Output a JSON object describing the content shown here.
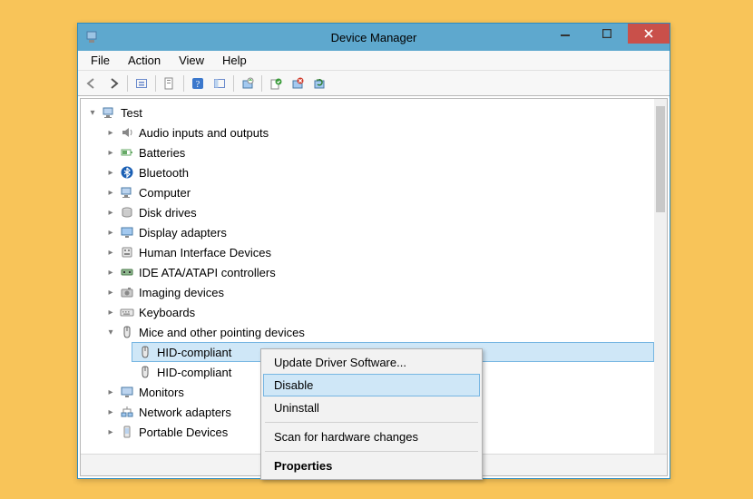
{
  "window": {
    "title": "Device Manager"
  },
  "menubar": [
    "File",
    "Action",
    "View",
    "Help"
  ],
  "toolbar": [
    {
      "name": "back-icon"
    },
    {
      "name": "forward-icon"
    },
    {
      "sep": true
    },
    {
      "name": "show-hidden-icon"
    },
    {
      "sep": true
    },
    {
      "name": "properties-icon"
    },
    {
      "sep": true
    },
    {
      "name": "help-icon"
    },
    {
      "name": "panel-icon"
    },
    {
      "sep": true
    },
    {
      "name": "update-driver-icon"
    },
    {
      "sep": true
    },
    {
      "name": "add-icon"
    },
    {
      "name": "uninstall-icon"
    },
    {
      "name": "scan-icon"
    }
  ],
  "tree": {
    "root": {
      "label": "Test",
      "expander": "▾",
      "icon": "computer-icon"
    },
    "categories": [
      {
        "label": "Audio inputs and outputs",
        "expander": "▸",
        "icon": "audio-icon"
      },
      {
        "label": "Batteries",
        "expander": "▸",
        "icon": "battery-icon"
      },
      {
        "label": "Bluetooth",
        "expander": "▸",
        "icon": "bluetooth-icon"
      },
      {
        "label": "Computer",
        "expander": "▸",
        "icon": "computer-icon"
      },
      {
        "label": "Disk drives",
        "expander": "▸",
        "icon": "disk-icon"
      },
      {
        "label": "Display adapters",
        "expander": "▸",
        "icon": "display-icon"
      },
      {
        "label": "Human Interface Devices",
        "expander": "▸",
        "icon": "hid-icon"
      },
      {
        "label": "IDE ATA/ATAPI controllers",
        "expander": "▸",
        "icon": "ide-icon"
      },
      {
        "label": "Imaging devices",
        "expander": "▸",
        "icon": "camera-icon"
      },
      {
        "label": "Keyboards",
        "expander": "▸",
        "icon": "keyboard-icon"
      },
      {
        "label": "Mice and other pointing devices",
        "expander": "▾",
        "icon": "mouse-icon",
        "children": [
          {
            "label": "HID-compliant",
            "icon": "mouse-icon",
            "selected": true
          },
          {
            "label": "HID-compliant",
            "icon": "mouse-icon",
            "selected": false
          }
        ]
      },
      {
        "label": "Monitors",
        "expander": "▸",
        "icon": "monitor-icon"
      },
      {
        "label": "Network adapters",
        "expander": "▸",
        "icon": "network-icon"
      },
      {
        "label": "Portable Devices",
        "expander": "▸",
        "icon": "portable-icon"
      }
    ]
  },
  "context_menu": {
    "items": [
      {
        "label": "Update Driver Software...",
        "type": "item"
      },
      {
        "label": "Disable",
        "type": "item",
        "hovered": true
      },
      {
        "label": "Uninstall",
        "type": "item"
      },
      {
        "type": "sep"
      },
      {
        "label": "Scan for hardware changes",
        "type": "item"
      },
      {
        "type": "sep"
      },
      {
        "label": "Properties",
        "type": "item",
        "bold": true
      }
    ]
  },
  "scrollbar": {
    "thumb_top_pct": 2,
    "thumb_height_pct": 30
  }
}
